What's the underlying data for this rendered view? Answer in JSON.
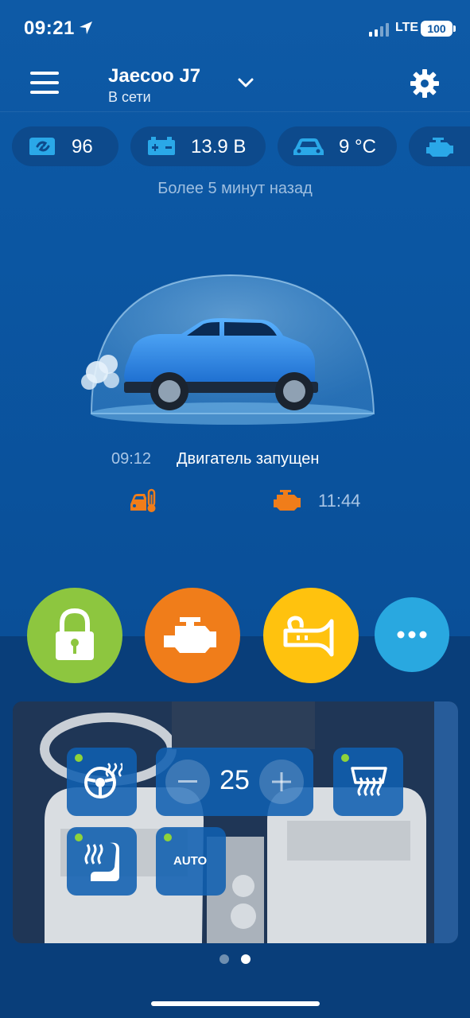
{
  "status_bar": {
    "time": "09:21",
    "network": "LTE",
    "battery": "100"
  },
  "header": {
    "title": "Jaecoo J7",
    "status": "В сети"
  },
  "chips": [
    {
      "icon": "fuel-level-icon",
      "value": "96"
    },
    {
      "icon": "battery-icon",
      "value": "13.9 В"
    },
    {
      "icon": "car-temperature-icon",
      "value": "9 °C"
    },
    {
      "icon": "engine-icon",
      "value": ""
    }
  ],
  "updated_text": "Более 5 минут назад",
  "event": {
    "time": "09:12",
    "text": "Двигатель запущен"
  },
  "indicators": {
    "engine_timer": "11:44"
  },
  "actions": [
    {
      "name": "lock",
      "icon": "lock-icon",
      "color": "#8dc63f"
    },
    {
      "name": "engine",
      "icon": "engine-icon",
      "color": "#f07d1a"
    },
    {
      "name": "horn",
      "icon": "horn-icon",
      "color": "#ffc20e"
    },
    {
      "name": "more",
      "icon": "more-icon",
      "color": "#29a8e0"
    }
  ],
  "climate": {
    "temperature": "25",
    "auto_label": "AUTO"
  },
  "pager": {
    "pages": 2,
    "active": 2
  },
  "colors": {
    "accent_orange": "#f07d1a",
    "chip_icon_blue": "#2aa8e8",
    "active_dot": "#8fd33a"
  }
}
